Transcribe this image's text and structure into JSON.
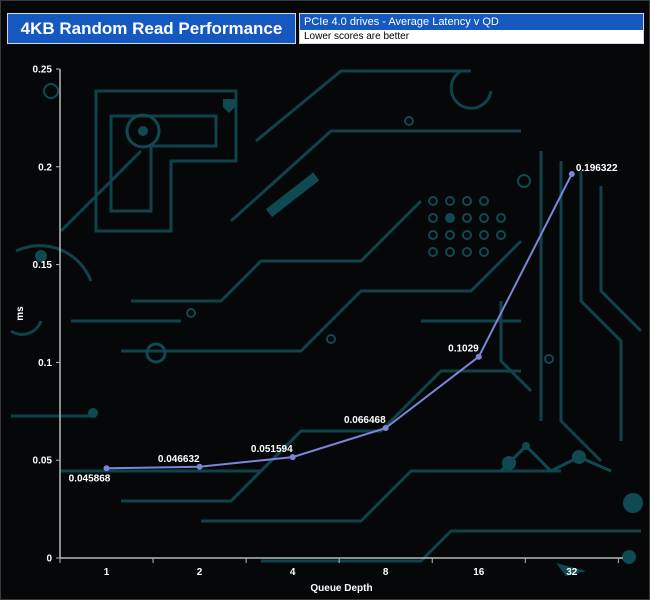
{
  "header": {
    "title": "4KB Random Read Performance",
    "subtitle_line1": "PCIe 4.0 drives -  Average Latency v QD",
    "subtitle_line2": "Lower scores are better"
  },
  "colors": {
    "title_bg": "#1558c0",
    "line": "#7b86d8",
    "axis": "#b8b8b8",
    "label": "#ffffff",
    "circuit": "#0f4a52"
  },
  "chart_data": {
    "type": "line",
    "categories": [
      "1",
      "2",
      "4",
      "8",
      "16",
      "32"
    ],
    "series": [
      {
        "values": [
          0.045868,
          0.046632,
          0.051594,
          0.066468,
          0.1029,
          0.196322
        ]
      }
    ],
    "data_labels": [
      "0.045868",
      "0.046632",
      "0.051594",
      "0.066468",
      "0.1029",
      "0.196322"
    ],
    "xlabel": "Queue Depth",
    "ylabel": "ms",
    "ylim": [
      0,
      0.25
    ],
    "yticks": [
      0,
      0.05,
      0.1,
      0.15,
      0.2,
      0.25
    ],
    "ytick_labels": [
      "0",
      "0.05",
      "0.1",
      "0.15",
      "0.2",
      "0.25"
    ],
    "grid": false,
    "legend": "none"
  }
}
